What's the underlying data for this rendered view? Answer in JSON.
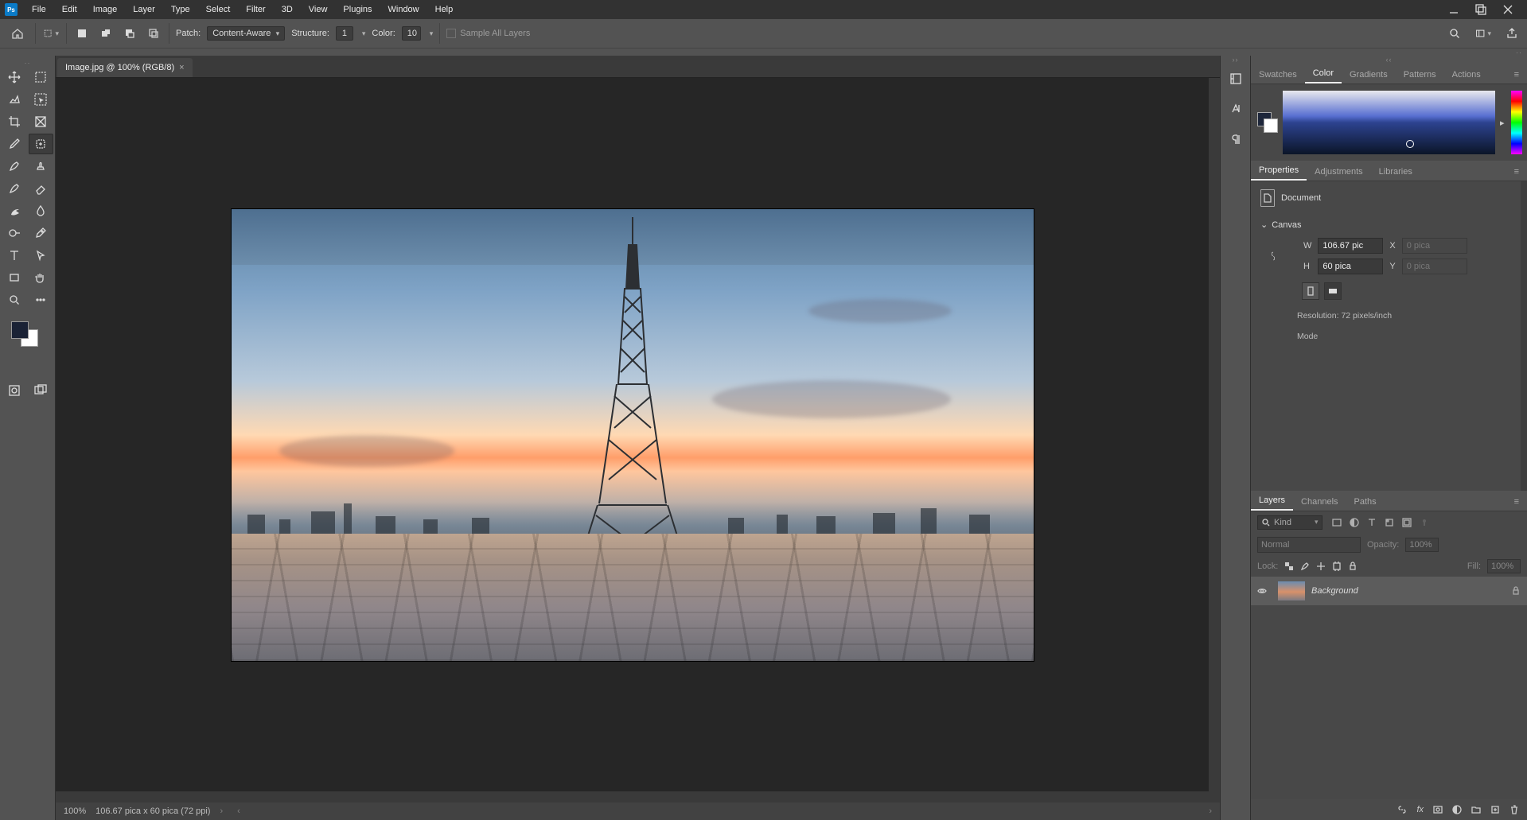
{
  "menubar": {
    "items": [
      "File",
      "Edit",
      "Image",
      "Layer",
      "Type",
      "Select",
      "Filter",
      "3D",
      "View",
      "Plugins",
      "Window",
      "Help"
    ]
  },
  "optionbar": {
    "patch_label": "Patch:",
    "patch_value": "Content-Aware",
    "structure_label": "Structure:",
    "structure_value": "1",
    "color_label": "Color:",
    "color_value": "10",
    "sample_label": "Sample All Layers"
  },
  "document": {
    "tab_title": "Image.jpg @ 100% (RGB/8)"
  },
  "color_panel": {
    "tabs": [
      "Swatches",
      "Color",
      "Gradients",
      "Patterns",
      "Actions"
    ],
    "active": 1
  },
  "properties_panel": {
    "tabs": [
      "Properties",
      "Adjustments",
      "Libraries"
    ],
    "doc_label": "Document",
    "section_canvas": "Canvas",
    "w_label": "W",
    "w_value": "106.67 pic",
    "h_label": "H",
    "h_value": "60 pica",
    "x_label": "X",
    "x_value": "0 pica",
    "y_label": "Y",
    "y_value": "0 pica",
    "resolution": "Resolution: 72 pixels/inch",
    "mode_label": "Mode"
  },
  "layers_panel": {
    "tabs": [
      "Layers",
      "Channels",
      "Paths"
    ],
    "filter_kind": "Kind",
    "blend_mode": "Normal",
    "opacity_label": "Opacity:",
    "opacity_value": "100%",
    "lock_label": "Lock:",
    "fill_label": "Fill:",
    "fill_value": "100%",
    "layer_name": "Background"
  },
  "statusbar": {
    "zoom": "100%",
    "doc_dim": "106.67 pica x 60 pica (72 ppi)"
  }
}
